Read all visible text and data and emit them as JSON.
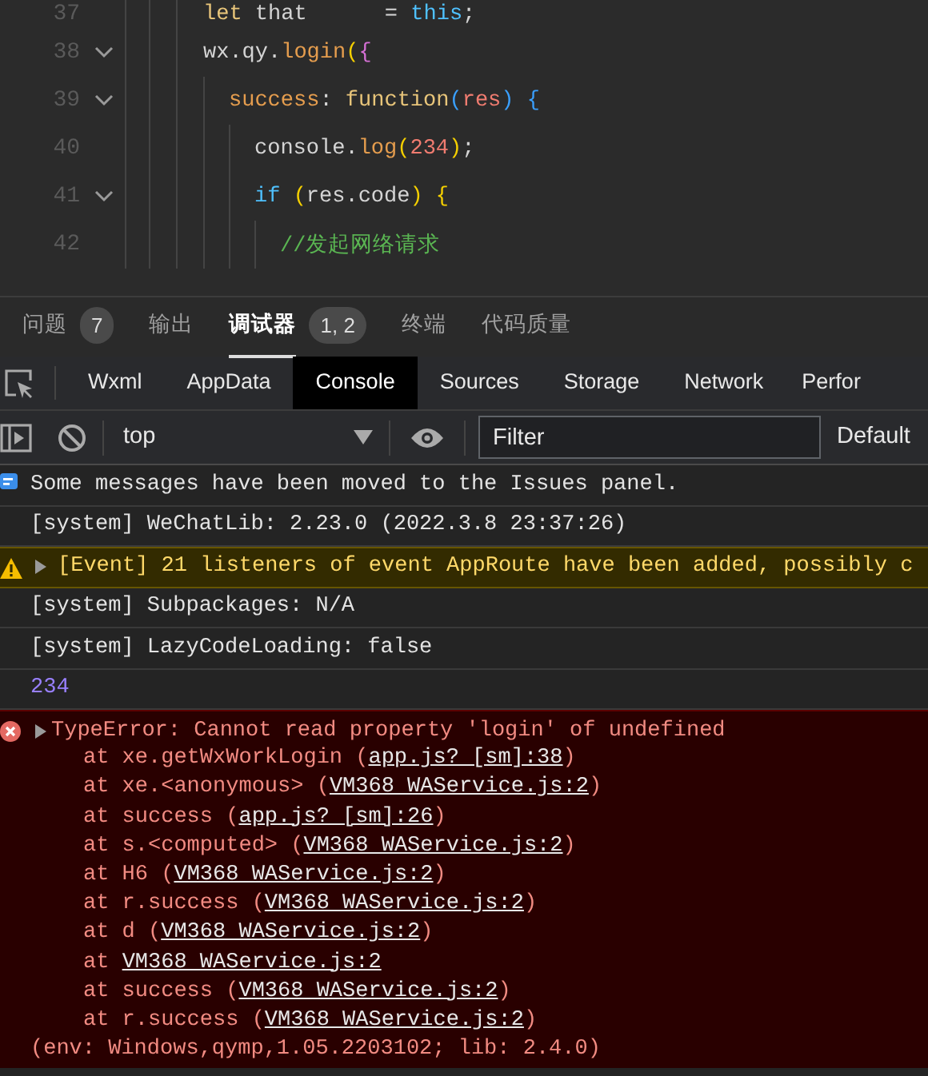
{
  "editor": {
    "lines": [
      {
        "number": "37",
        "foldable": false,
        "tokens": [
          {
            "text": "let",
            "kind": "keyword"
          },
          {
            "text": " that      = ",
            "kind": "plain"
          },
          {
            "text": "this",
            "kind": "control"
          },
          {
            "text": ";",
            "kind": "plain"
          }
        ]
      },
      {
        "number": "38",
        "foldable": true,
        "tokens": [
          {
            "text": "wx.qy.",
            "kind": "plain"
          },
          {
            "text": "login",
            "kind": "method"
          },
          {
            "text": "(",
            "kind": "bracket1"
          },
          {
            "text": "{",
            "kind": "bracket2"
          }
        ],
        "children": [
          {
            "number": "39",
            "foldable": true,
            "tokens": [
              {
                "text": "success",
                "kind": "method"
              },
              {
                "text": ": ",
                "kind": "plain"
              },
              {
                "text": "function",
                "kind": "keyword"
              },
              {
                "text": "(",
                "kind": "bracket3"
              },
              {
                "text": "res",
                "kind": "param"
              },
              {
                "text": ") {",
                "kind": "bracket3"
              }
            ],
            "children": [
              {
                "number": "40",
                "foldable": false,
                "tokens": [
                  {
                    "text": "console.",
                    "kind": "plain"
                  },
                  {
                    "text": "log",
                    "kind": "method"
                  },
                  {
                    "text": "(",
                    "kind": "bracket1"
                  },
                  {
                    "text": "234",
                    "kind": "number"
                  },
                  {
                    "text": ")",
                    "kind": "bracket1"
                  },
                  {
                    "text": ";",
                    "kind": "plain"
                  }
                ]
              },
              {
                "number": "41",
                "foldable": true,
                "tokens": [
                  {
                    "text": "if ",
                    "kind": "control"
                  },
                  {
                    "text": "(",
                    "kind": "bracket1"
                  },
                  {
                    "text": "res.code",
                    "kind": "plain"
                  },
                  {
                    "text": ") {",
                    "kind": "bracket1"
                  }
                ],
                "children": [
                  {
                    "number": "42",
                    "foldable": false,
                    "tokens": [
                      {
                        "text": "//发起网络请求",
                        "kind": "comment"
                      }
                    ]
                  }
                ]
              }
            ]
          }
        ]
      }
    ]
  },
  "panel_tabs": [
    {
      "label": "问题",
      "badge": "7",
      "selected": false
    },
    {
      "label": "输出",
      "selected": false
    },
    {
      "label": "调试器",
      "badge": "1, 2",
      "selected": true
    },
    {
      "label": "终端",
      "selected": false
    },
    {
      "label": "代码质量",
      "selected": false
    }
  ],
  "devtools_tabs": [
    {
      "label": "Wxml",
      "selected": false
    },
    {
      "label": "AppData",
      "selected": false
    },
    {
      "label": "Console",
      "selected": true
    },
    {
      "label": "Sources",
      "selected": false
    },
    {
      "label": "Storage",
      "selected": false
    },
    {
      "label": "Network",
      "selected": false
    },
    {
      "label": "Perfor",
      "selected": false
    }
  ],
  "console_toolbar": {
    "context": "top",
    "filter": {
      "placeholder": "Filter"
    },
    "levels": "Default"
  },
  "messages": [
    {
      "kind": "info",
      "text": "Some messages have been moved to the Issues panel."
    },
    {
      "kind": "log",
      "text": "[system] WeChatLib: 2.23.0 (2022.3.8 23:37:26)"
    },
    {
      "kind": "warning",
      "text": "[Event] 21 listeners of event AppRoute have been added, possibly c"
    },
    {
      "kind": "log",
      "text": "[system] Subpackages: N/A"
    },
    {
      "kind": "log",
      "text": "[system] LazyCodeLoading: false"
    },
    {
      "kind": "number",
      "text": "234"
    },
    {
      "kind": "error",
      "text": "TypeError: Cannot read property 'login' of undefined",
      "stack": [
        {
          "before": "at xe.getWxWorkLogin (",
          "link": "app.js? [sm]:38",
          "after": ")"
        },
        {
          "before": "at xe.<anonymous> (",
          "link": "VM368 WAService.js:2",
          "after": ")"
        },
        {
          "before": "at success (",
          "link": "app.js? [sm]:26",
          "after": ")"
        },
        {
          "before": "at s.<computed> (",
          "link": "VM368 WAService.js:2",
          "after": ")"
        },
        {
          "before": "at H6 (",
          "link": "VM368 WAService.js:2",
          "after": ")"
        },
        {
          "before": "at r.success (",
          "link": "VM368 WAService.js:2",
          "after": ")"
        },
        {
          "before": "at d (",
          "link": "VM368 WAService.js:2",
          "after": ")"
        },
        {
          "before": "at ",
          "link": "VM368 WAService.js:2"
        },
        {
          "before": "at success (",
          "link": "VM368 WAService.js:2",
          "after": ")"
        },
        {
          "before": "at r.success (",
          "link": "VM368 WAService.js:2",
          "after": ")"
        }
      ],
      "footer": "(env: Windows,qymp,1.05.2203102; lib: 2.4.0)"
    }
  ]
}
